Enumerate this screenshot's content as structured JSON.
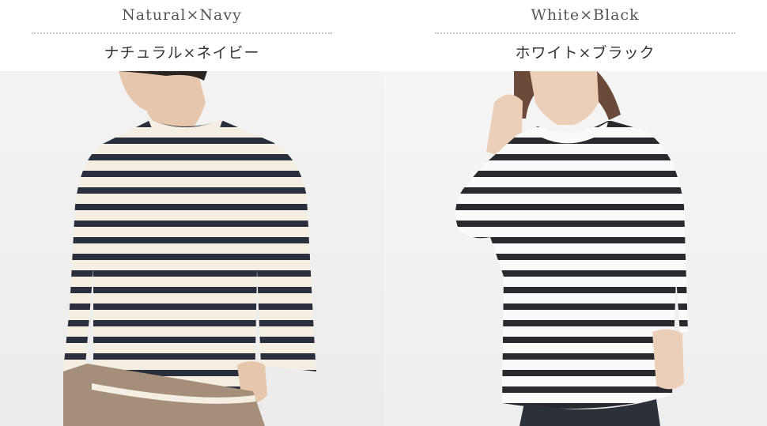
{
  "colors": {
    "left_caption_en": "Natural×Navy",
    "left_caption_ja": "ナチュラル×ネイビー",
    "right_caption_en": "White×Black",
    "right_caption_ja": "ホワイト×ブラック"
  },
  "palette": {
    "stripe_navy": "#2b2f3d",
    "stripe_black": "#2a2a2e",
    "natural": "#f4efe2",
    "white": "#fafafa"
  },
  "icons": [
    "model-photo-man",
    "model-photo-woman"
  ]
}
